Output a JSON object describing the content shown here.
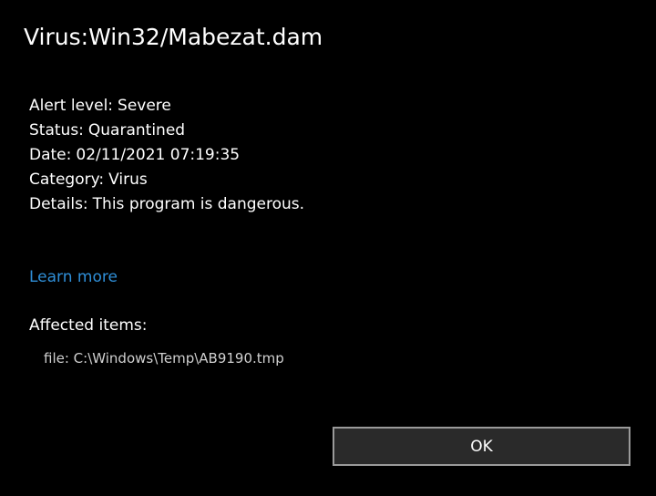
{
  "dialog": {
    "title": "Virus:Win32/Mabezat.dam",
    "fields": [
      {
        "label": "Alert level:",
        "value": "Severe"
      },
      {
        "label": "Status:",
        "value": "Quarantined"
      },
      {
        "label": "Date:",
        "value": "02/11/2021 07:19:35"
      },
      {
        "label": "Category:",
        "value": "Virus"
      },
      {
        "label": "Details:",
        "value": "This program is dangerous."
      }
    ],
    "learn_more": "Learn more",
    "affected_heading": "Affected items:",
    "affected_items": [
      "file: C:\\Windows\\Temp\\AB9190.tmp"
    ],
    "ok_label": "OK"
  },
  "colors": {
    "background": "#000000",
    "text": "#ffffff",
    "link": "#2f8fd8",
    "secondary_text": "#cfcfcf",
    "button_border": "#9a9a9a",
    "button_fill": "#2a2a2a"
  }
}
